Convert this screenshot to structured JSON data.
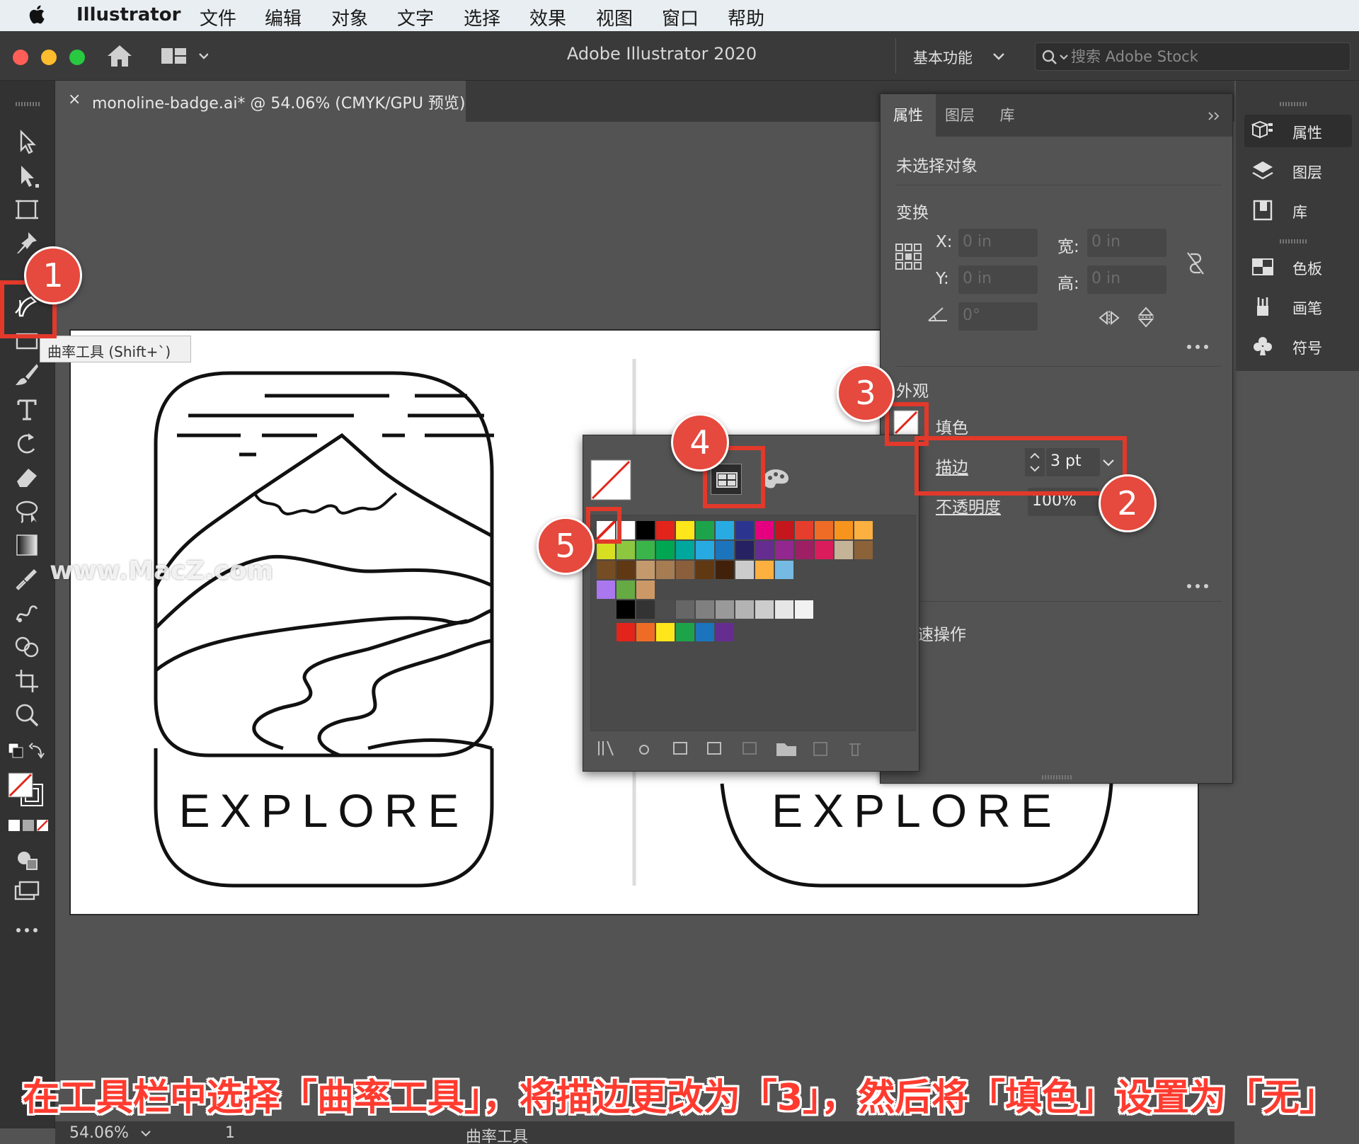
{
  "menubar": {
    "app": "Illustrator",
    "items": [
      "文件",
      "编辑",
      "对象",
      "文字",
      "选择",
      "效果",
      "视图",
      "窗口",
      "帮助"
    ]
  },
  "titlebar": {
    "title": "Adobe Illustrator 2020",
    "workspace": "基本功能",
    "search_placeholder": "搜索 Adobe Stock"
  },
  "document": {
    "tab_label": "monoline-badge.ai* @ 54.06% (CMYK/GPU 预览)",
    "close": "×"
  },
  "toolbar": {
    "tooltip": "曲率工具 (Shift+`)"
  },
  "artwork": {
    "left_text": "EXPLORE",
    "right_text": "EXPLORE"
  },
  "properties": {
    "tabs": [
      "属性",
      "图层",
      "库"
    ],
    "no_selection": "未选择对象",
    "transform": "变换",
    "x_label": "X:",
    "x_value": "0 in",
    "y_label": "Y:",
    "y_value": "0 in",
    "w_label": "宽:",
    "w_value": "0 in",
    "h_label": "高:",
    "h_value": "0 in",
    "angle_value": "0°",
    "appearance": "外观",
    "fill_label": "填色",
    "stroke_label": "描边",
    "stroke_value": "3 pt",
    "opacity_label": "不透明度",
    "opacity_value": "100%",
    "quick_actions": "速操作"
  },
  "dock": {
    "items": [
      "属性",
      "图层",
      "库",
      "色板",
      "画笔",
      "符号"
    ]
  },
  "status": {
    "zoom": "54.06%",
    "page": "1",
    "tool": "曲率工具"
  },
  "callouts": [
    "1",
    "2",
    "3",
    "4",
    "5"
  ],
  "caption": "在工具栏中选择「曲率工具」，将描边更改为「3」，然后将「填色」设置为「无」",
  "watermark": "www.MacZ.com",
  "colors": {
    "accent_red": "#e2392b",
    "panel_bg": "#535353",
    "dark_bg": "#323232"
  }
}
